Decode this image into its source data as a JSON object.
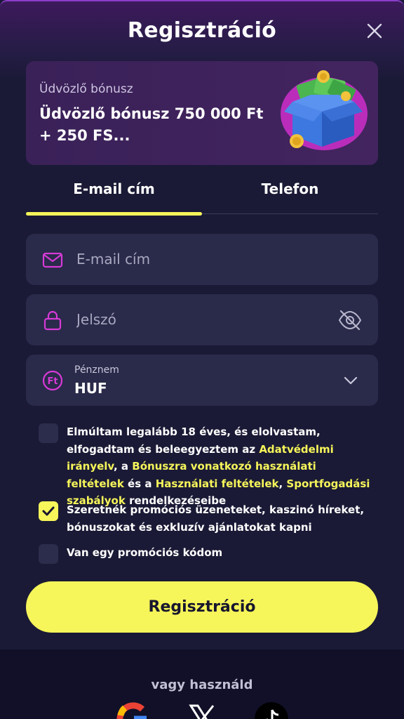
{
  "header": {
    "title": "Regisztráció"
  },
  "bonus": {
    "label": "Üdvözlő bónusz",
    "text": "Üdvözlő bónusz 750 000 Ft + 250 FS..."
  },
  "tabs": [
    {
      "label": "E-mail cím",
      "active": true
    },
    {
      "label": "Telefon",
      "active": false
    }
  ],
  "form": {
    "email_placeholder": "E-mail cím",
    "password_placeholder": "Jelszó",
    "currency_label": "Pénznem",
    "currency_value": "HUF"
  },
  "consents": {
    "age": {
      "checked": false,
      "text_1": "Elmúltam legalább 18 éves, és elolvastam, elfogadtam és beleegyeztem az ",
      "link_privacy": "Adatvédelmi irányelv",
      "text_2": ", a ",
      "link_bonus": "Bónuszra vonatkozó használati feltételek",
      "text_3": " és a ",
      "link_terms": "Használati feltételek",
      "text_4": ", ",
      "link_sports": "Sportfogadási szabályok",
      "text_5": " rendelkezéseibe"
    },
    "promo_messages": {
      "checked": true,
      "text": "Szeretnék promóciós üzeneteket, kaszinó híreket, bónuszokat és exkluzív ajánlatokat kapni"
    },
    "promo_code": {
      "checked": false,
      "text": "Van egy promóciós kódom"
    }
  },
  "register_button": "Regisztráció",
  "footer": {
    "or_text": "vagy használd"
  },
  "icons": {
    "close": "close-icon",
    "email": "mail-icon",
    "password": "lock-icon",
    "visibility": "eye-off-icon",
    "currency": "forint-icon",
    "dropdown": "chevron-down-icon",
    "check": "check-icon",
    "google": "google-icon",
    "x": "x-icon",
    "tiktok": "tiktok-icon"
  },
  "colors": {
    "accent": "#f6f55a",
    "icon": "#d63ad6",
    "background": "#1a1a36",
    "field": "#2a2a4a"
  }
}
